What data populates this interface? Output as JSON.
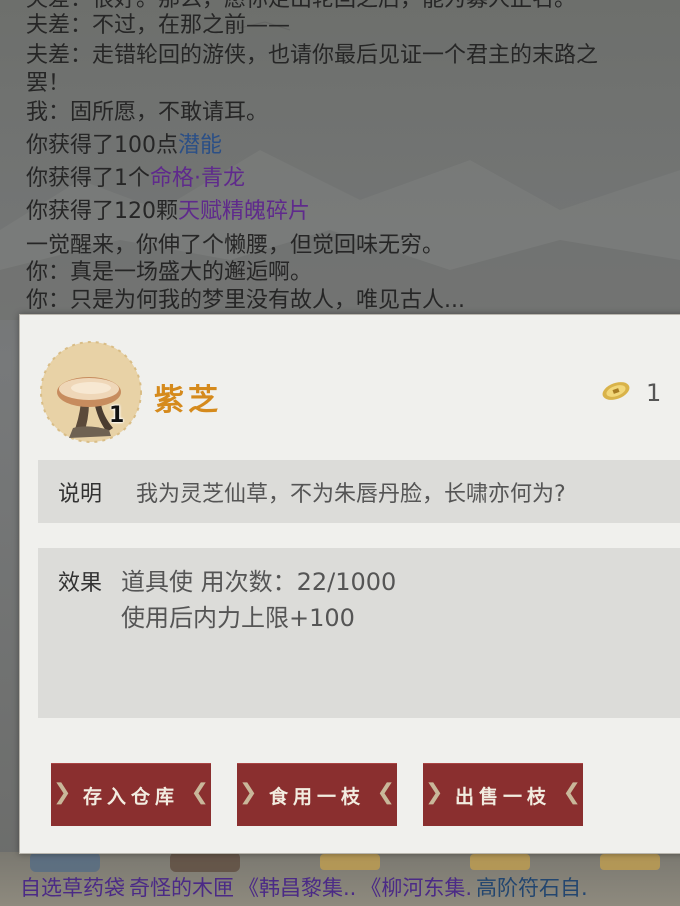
{
  "log": [
    {
      "parts": [
        {
          "text": "夫差：很好。那么，愿你走出轮回之后，能为募人正名。",
          "color": "normal"
        }
      ]
    },
    {
      "parts": [
        {
          "text": "夫差：不过，在那之前——",
          "color": "normal"
        }
      ]
    },
    {
      "parts": [
        {
          "text": "夫差：走错轮回的游侠，也请你最后见证一个君主的末路之",
          "color": "normal"
        }
      ]
    },
    {
      "parts": [
        {
          "text": "罢！",
          "color": "normal"
        }
      ]
    },
    {
      "parts": [
        {
          "text": "我：固所愿，不敢请耳。",
          "color": "normal"
        }
      ]
    },
    {
      "parts": [
        {
          "text": "你获得了100点",
          "color": "normal"
        },
        {
          "text": "潜能",
          "color": "blue"
        }
      ]
    },
    {
      "parts": [
        {
          "text": "你获得了1个",
          "color": "normal"
        },
        {
          "text": "命格·青龙",
          "color": "purple"
        }
      ]
    },
    {
      "parts": [
        {
          "text": "你获得了120颗",
          "color": "normal"
        },
        {
          "text": "天赋精魄碎片",
          "color": "purple"
        }
      ]
    },
    {
      "parts": [
        {
          "text": "一觉醒来，你伸了个懒腰，但觉回味无穷。",
          "color": "normal"
        }
      ]
    },
    {
      "parts": [
        {
          "text": "你：真是一场盛大的邂逅啊。",
          "color": "normal"
        }
      ]
    },
    {
      "parts": [
        {
          "text": "你：只是为何我的梦里没有故人，唯见古人...",
          "color": "normal"
        }
      ]
    }
  ],
  "item": {
    "name": "紫芝",
    "count": "1",
    "icon": "lingzhi-mushroom-icon",
    "price": "1",
    "price_icon": "coin-icon",
    "desc_label": "说明",
    "desc_text": "我为灵芝仙草，不为朱唇丹脸，长啸亦何为?",
    "effect_label": "效果",
    "effect_lines": [
      "道具使 用次数：22/1000",
      "使用后内力上限+100"
    ]
  },
  "buttons": {
    "store": "存入仓库",
    "eat": "食用一枝",
    "sell": "出售一枝"
  },
  "bottom_items": [
    {
      "text": "自选草药袋",
      "color": "purple"
    },
    {
      "text": "奇怪的木匣",
      "color": "purple"
    },
    {
      "text": "《韩昌黎集..",
      "color": "purple"
    },
    {
      "text": "《柳河东集.",
      "color": "purple"
    },
    {
      "text": "高阶符石自.",
      "color": "blue"
    }
  ],
  "colors": {
    "accent_button": "#8a2f2f",
    "item_name": "#d58a1c",
    "text_blue": "#2b4f86",
    "text_purple": "#5f2a8c"
  }
}
